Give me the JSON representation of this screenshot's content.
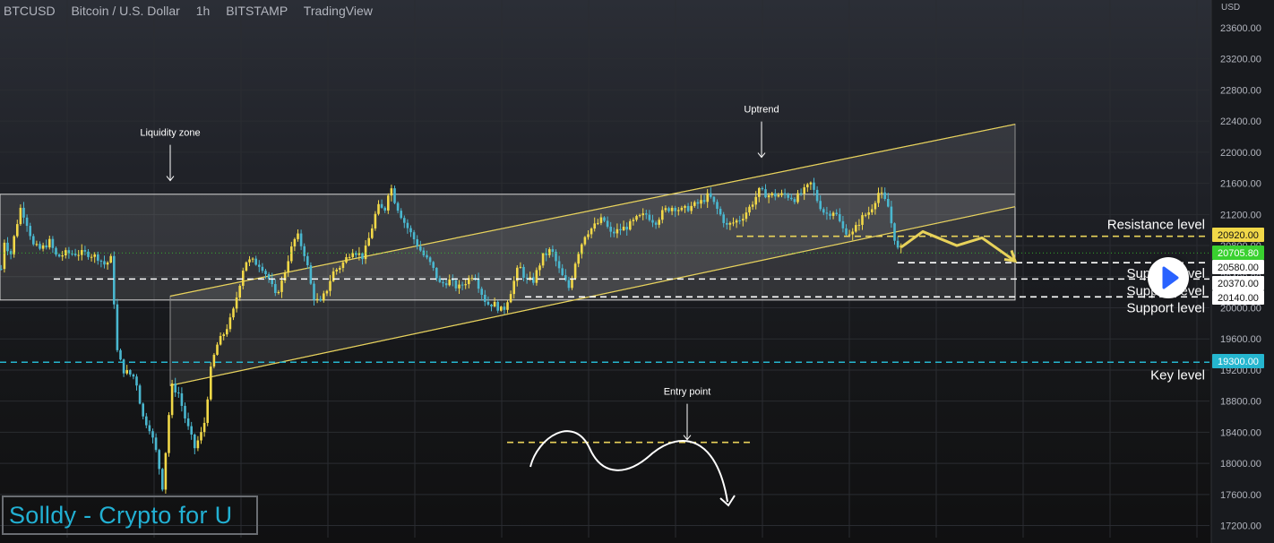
{
  "header": {
    "symbol": "BTCUSD",
    "name": "Bitcoin / U.S. Dollar",
    "interval": "1h",
    "exchange": "BITSTAMP",
    "source": "TradingView"
  },
  "currency_label": "USD",
  "watermark": "Solldy - Crypto for U",
  "colors": {
    "up": "#f1d848",
    "down": "#4ab7cf",
    "trend": "#e8d25a",
    "key": "#25b6cf",
    "annotation": "#ffffff",
    "grid": "#2a2c31",
    "axis_text": "#b2b5be"
  },
  "chart_data": {
    "type": "candlestick",
    "symbol": "BTCUSD",
    "interval": "1h",
    "ylim": [
      17000,
      23850
    ],
    "y_ticks": [
      17200,
      17600,
      18000,
      18400,
      18800,
      19200,
      19600,
      20000,
      20400,
      20800,
      21200,
      21600,
      22000,
      22400,
      22800,
      23200,
      23600
    ],
    "y_tick_labels": [
      "17200.00",
      "17600.00",
      "18000.00",
      "18400.00",
      "18800.00",
      "19200.00",
      "19600.00",
      "20000.00",
      "20400.00",
      "20800.00",
      "21200.00",
      "21600.00",
      "22000.00",
      "22400.00",
      "22800.00",
      "23200.00",
      "23600.00"
    ],
    "price_path": [
      [
        0,
        20500
      ],
      [
        4,
        20900
      ],
      [
        10,
        20650
      ],
      [
        16,
        21000
      ],
      [
        22,
        21300
      ],
      [
        30,
        21050
      ],
      [
        36,
        20800
      ],
      [
        44,
        20750
      ],
      [
        54,
        20850
      ],
      [
        62,
        20650
      ],
      [
        72,
        20700
      ],
      [
        84,
        20700
      ],
      [
        96,
        20700
      ],
      [
        108,
        20650
      ],
      [
        116,
        20550
      ],
      [
        124,
        20650
      ],
      [
        128,
        19500
      ],
      [
        136,
        19200
      ],
      [
        150,
        19100
      ],
      [
        158,
        18600
      ],
      [
        166,
        18450
      ],
      [
        174,
        18100
      ],
      [
        180,
        17700
      ],
      [
        184,
        18200
      ],
      [
        190,
        19000
      ],
      [
        198,
        18900
      ],
      [
        206,
        18550
      ],
      [
        216,
        18200
      ],
      [
        226,
        18450
      ],
      [
        234,
        19200
      ],
      [
        240,
        19500
      ],
      [
        250,
        19700
      ],
      [
        258,
        19900
      ],
      [
        266,
        20300
      ],
      [
        272,
        20600
      ],
      [
        280,
        20600
      ],
      [
        290,
        20550
      ],
      [
        300,
        20350
      ],
      [
        306,
        20150
      ],
      [
        314,
        20350
      ],
      [
        322,
        20700
      ],
      [
        330,
        20950
      ],
      [
        340,
        20650
      ],
      [
        348,
        20150
      ],
      [
        356,
        20050
      ],
      [
        364,
        20250
      ],
      [
        370,
        20450
      ],
      [
        380,
        20550
      ],
      [
        392,
        20750
      ],
      [
        404,
        20650
      ],
      [
        412,
        20950
      ],
      [
        420,
        21300
      ],
      [
        428,
        21250
      ],
      [
        434,
        21600
      ],
      [
        440,
        21350
      ],
      [
        450,
        21100
      ],
      [
        460,
        20900
      ],
      [
        470,
        20700
      ],
      [
        480,
        20550
      ],
      [
        490,
        20300
      ],
      [
        500,
        20350
      ],
      [
        510,
        20250
      ],
      [
        520,
        20350
      ],
      [
        528,
        20450
      ],
      [
        534,
        20250
      ],
      [
        542,
        20050
      ],
      [
        550,
        20050
      ],
      [
        560,
        19950
      ],
      [
        570,
        20250
      ],
      [
        578,
        20550
      ],
      [
        586,
        20350
      ],
      [
        594,
        20350
      ],
      [
        604,
        20650
      ],
      [
        614,
        20750
      ],
      [
        624,
        20450
      ],
      [
        634,
        20250
      ],
      [
        642,
        20650
      ],
      [
        652,
        20950
      ],
      [
        662,
        21050
      ],
      [
        672,
        21150
      ],
      [
        680,
        20950
      ],
      [
        690,
        21000
      ],
      [
        700,
        21050
      ],
      [
        710,
        21150
      ],
      [
        720,
        21200
      ],
      [
        730,
        21100
      ],
      [
        740,
        21250
      ],
      [
        750,
        21300
      ],
      [
        760,
        21250
      ],
      [
        770,
        21300
      ],
      [
        780,
        21350
      ],
      [
        790,
        21450
      ],
      [
        800,
        21250
      ],
      [
        810,
        21050
      ],
      [
        818,
        21100
      ],
      [
        826,
        21150
      ],
      [
        836,
        21300
      ],
      [
        846,
        21500
      ],
      [
        856,
        21450
      ],
      [
        866,
        21450
      ],
      [
        876,
        21450
      ],
      [
        886,
        21400
      ],
      [
        896,
        21500
      ],
      [
        904,
        21600
      ],
      [
        912,
        21350
      ],
      [
        920,
        21200
      ],
      [
        930,
        21250
      ],
      [
        940,
        21000
      ],
      [
        950,
        20950
      ],
      [
        960,
        21150
      ],
      [
        970,
        21250
      ],
      [
        980,
        21500
      ],
      [
        990,
        21300
      ],
      [
        996,
        20950
      ],
      [
        1002,
        20700
      ],
      [
        1006,
        20800
      ]
    ],
    "levels": [
      {
        "label": "Resistance level",
        "price": 20920,
        "tag": "20920.00",
        "tag_color": "#f1d848",
        "style": "dashed-yellow"
      },
      {
        "label": "",
        "price": 20705.8,
        "tag": "20705.80",
        "tag_color": "#39d12f",
        "style": "last-price"
      },
      {
        "label": "Support level",
        "price": 20580,
        "tag": "20580.00",
        "tag_color": "#ffffff",
        "style": "dashed-white"
      },
      {
        "label": "Support level",
        "price": 20370,
        "tag": "20370.00",
        "tag_color": "#ffffff",
        "style": "dashed-white"
      },
      {
        "label": "Support level",
        "price": 20140,
        "tag": "20140.00",
        "tag_color": "#ffffff",
        "style": "dashed-white"
      },
      {
        "label": "Key level",
        "price": 19300,
        "tag": "19300.00",
        "tag_color": "#25b6cf",
        "style": "dashed-cyan"
      }
    ],
    "annotations": [
      {
        "label": "Liquidity zone",
        "anchor_price": 21600
      },
      {
        "label": "Uptrend",
        "anchor_price": 21900
      },
      {
        "label": "Entry point",
        "anchor_price": 18270
      }
    ],
    "liquidity_zone": {
      "from": 20100,
      "to": 21460
    },
    "entry_line": 18270,
    "channel": {
      "upper": [
        [
          190,
          20150
        ],
        [
          1133,
          22360
        ]
      ],
      "lower": [
        [
          190,
          19000
        ],
        [
          1133,
          21300
        ]
      ]
    },
    "projection": [
      [
        1006,
        20780
      ],
      [
        1030,
        20980
      ],
      [
        1068,
        20800
      ],
      [
        1096,
        20900
      ],
      [
        1133,
        20600
      ]
    ]
  }
}
